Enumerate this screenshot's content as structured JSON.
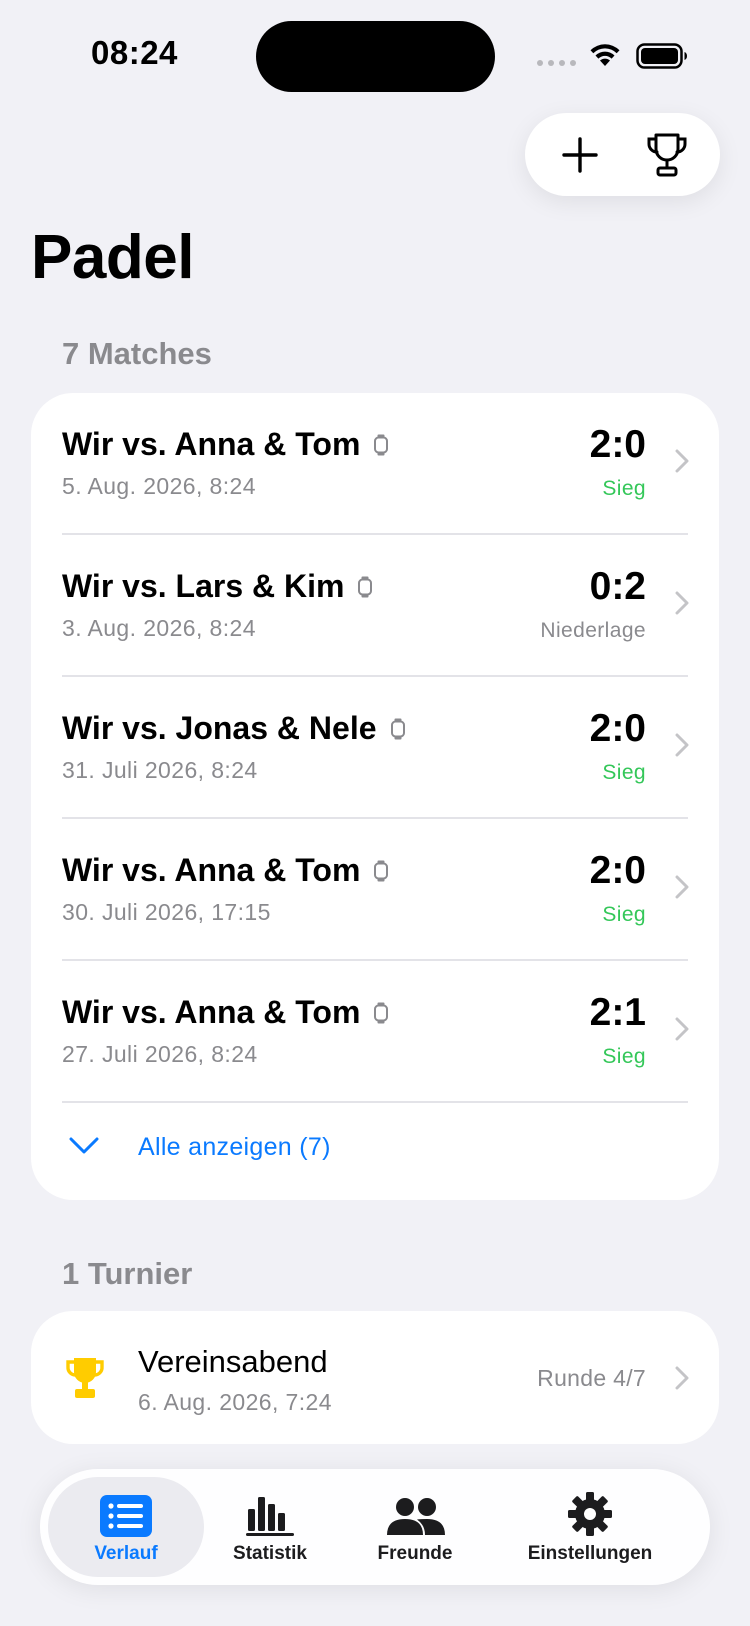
{
  "status_bar": {
    "time": "08:24"
  },
  "header": {
    "title": "Padel"
  },
  "matches": {
    "section_label": "7 Matches",
    "items": [
      {
        "title": "Wir vs. Anna & Tom",
        "date": "5. Aug. 2026, 8:24",
        "score": "2:0",
        "result": "Sieg",
        "outcome": "win"
      },
      {
        "title": "Wir vs. Lars & Kim",
        "date": "3. Aug. 2026, 8:24",
        "score": "0:2",
        "result": "Niederlage",
        "outcome": "loss"
      },
      {
        "title": "Wir vs. Jonas & Nele",
        "date": "31. Juli 2026, 8:24",
        "score": "2:0",
        "result": "Sieg",
        "outcome": "win"
      },
      {
        "title": "Wir vs. Anna & Tom",
        "date": "30. Juli 2026, 17:15",
        "score": "2:0",
        "result": "Sieg",
        "outcome": "win"
      },
      {
        "title": "Wir vs. Anna & Tom",
        "date": "27. Juli 2026, 8:24",
        "score": "2:1",
        "result": "Sieg",
        "outcome": "win"
      }
    ],
    "show_all_label": "Alle anzeigen (7)"
  },
  "tournaments": {
    "section_label": "1 Turnier",
    "items": [
      {
        "title": "Vereinsabend",
        "date": "6. Aug. 2026, 7:24",
        "round": "Runde 4/7"
      }
    ]
  },
  "tab_bar": {
    "tabs": [
      {
        "label": "Verlauf",
        "icon": "list-icon",
        "active": true
      },
      {
        "label": "Statistik",
        "icon": "bar-chart-icon",
        "active": false
      },
      {
        "label": "Freunde",
        "icon": "people-icon",
        "active": false
      },
      {
        "label": "Einstellungen",
        "icon": "gear-icon",
        "active": false
      }
    ]
  },
  "colors": {
    "accent": "#0A7AFF",
    "win": "#34C759",
    "secondary_text": "#8A8A8E",
    "background": "#F1F1F6",
    "trophy": "#FFCC00"
  }
}
